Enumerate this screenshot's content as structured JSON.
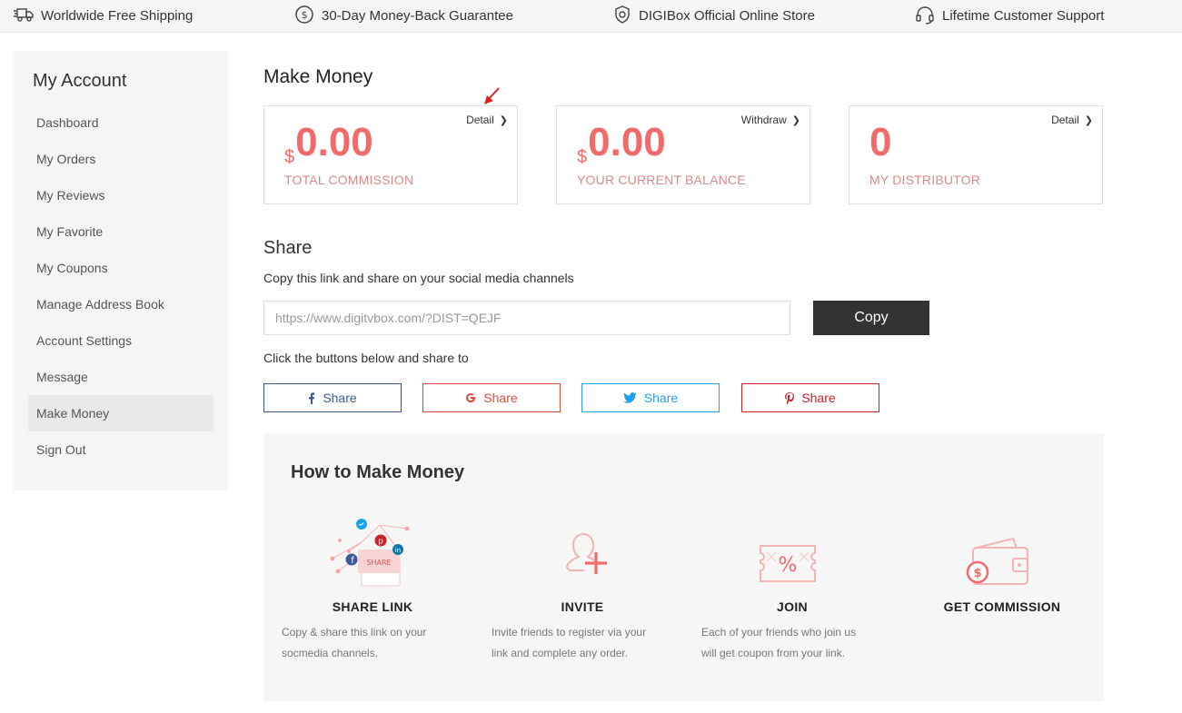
{
  "topbar": {
    "items": [
      {
        "icon": "truck-icon",
        "label": "Worldwide Free Shipping"
      },
      {
        "icon": "money-back-icon",
        "label": "30-Day Money-Back Guarantee"
      },
      {
        "icon": "shield-icon",
        "label": "DIGIBox Official Online Store"
      },
      {
        "icon": "headset-icon",
        "label": "Lifetime Customer Support"
      }
    ]
  },
  "sidebar": {
    "title": "My Account",
    "items": [
      {
        "label": "Dashboard"
      },
      {
        "label": "My Orders"
      },
      {
        "label": "My Reviews"
      },
      {
        "label": "My Favorite"
      },
      {
        "label": "My Coupons"
      },
      {
        "label": "Manage Address Book"
      },
      {
        "label": "Account Settings"
      },
      {
        "label": "Message"
      },
      {
        "label": "Make Money",
        "active": true
      },
      {
        "label": "Sign Out"
      }
    ]
  },
  "main": {
    "title": "Make Money",
    "cards": [
      {
        "link": "Detail",
        "currency": "$",
        "value": "0.00",
        "label": "TOTAL COMMISSION"
      },
      {
        "link": "Withdraw",
        "currency": "$",
        "value": "0.00",
        "label": "YOUR CURRENT BALANCE"
      },
      {
        "link": "Detail",
        "currency": "",
        "value": "0",
        "label": "MY DISTRIBUTOR"
      }
    ],
    "share": {
      "title": "Share",
      "description": "Copy this link and share on your social media channels",
      "link_value": "https://www.digitvbox.com/?DIST=QEJF",
      "copy_label": "Copy",
      "share_to": "Click the buttons below and share to",
      "buttons": [
        {
          "icon": "facebook-icon",
          "label": "Share",
          "color": "#3b5998"
        },
        {
          "icon": "google-icon",
          "label": "Share",
          "color": "#dd4b39"
        },
        {
          "icon": "twitter-icon",
          "label": "Share",
          "color": "#1da1f2"
        },
        {
          "icon": "pinterest-icon",
          "label": "Share",
          "color": "#cb2027"
        }
      ]
    },
    "howto": {
      "title": "How to Make Money",
      "steps": [
        {
          "icon": "share-link-illustration",
          "badge": "SHARE",
          "title": "SHARE LINK",
          "desc": "Copy & share this link on your socmedia channels."
        },
        {
          "icon": "invite-user-icon",
          "title": "INVITE",
          "desc": "Invite friends to register via your link and complete any order."
        },
        {
          "icon": "coupon-icon",
          "title": "JOIN",
          "desc": "Each of your friends who join us will get coupon from your link."
        },
        {
          "icon": "wallet-icon",
          "title": "GET COMMISSION",
          "desc": ""
        }
      ]
    }
  },
  "colors": {
    "accent": "#f26b6b",
    "label_pink": "#d98a8a",
    "dark_button": "#333333"
  }
}
